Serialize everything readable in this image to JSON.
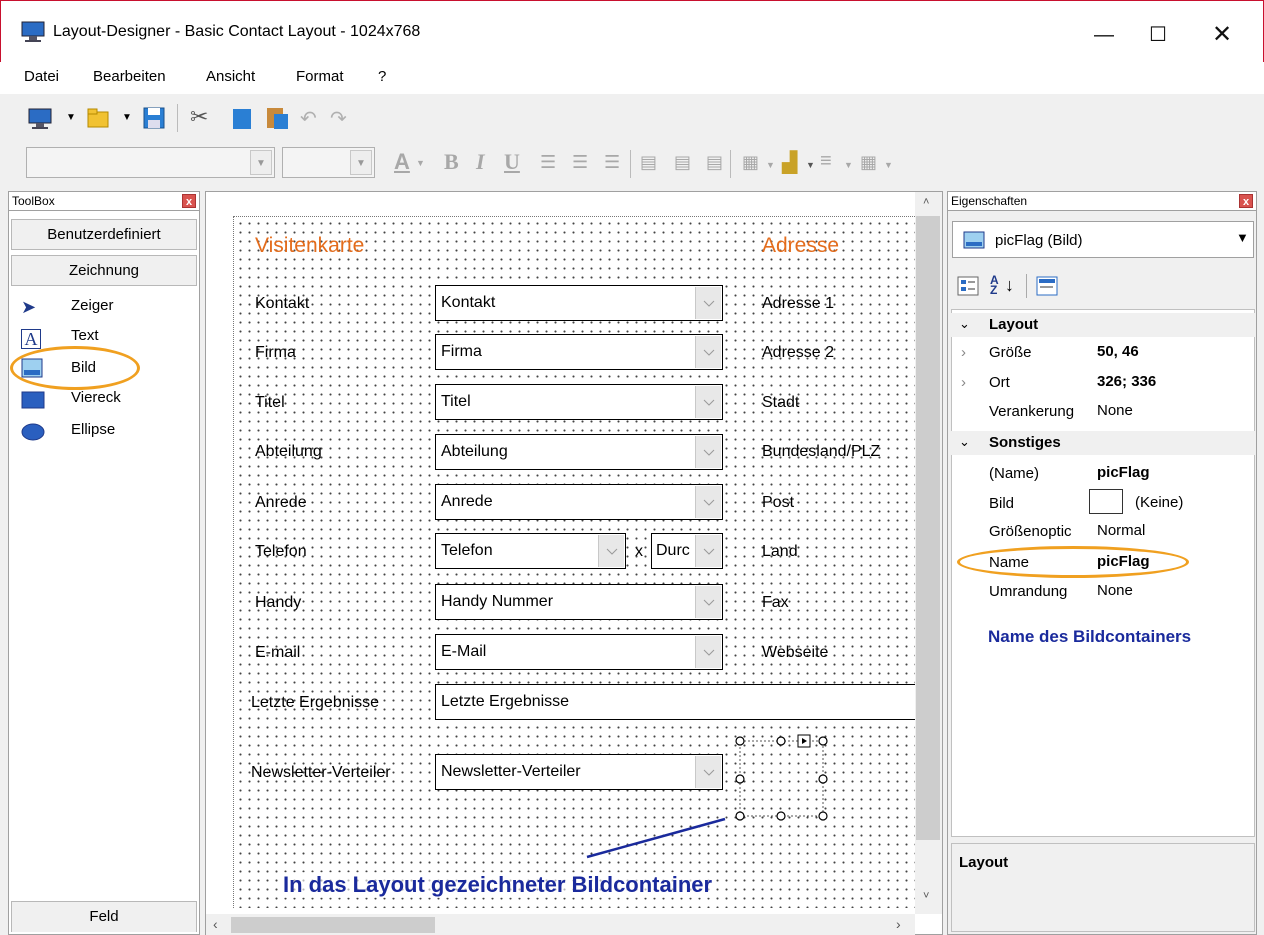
{
  "window": {
    "title": "Layout-Designer - Basic Contact Layout - 1024x768"
  },
  "menu": [
    "Datei",
    "Bearbeiten",
    "Ansicht",
    "Format",
    "?"
  ],
  "toolbox": {
    "title": "ToolBox",
    "sections": [
      "Benutzerdefiniert",
      "Zeichnung"
    ],
    "tools": [
      "Zeiger",
      "Text",
      "Bild",
      "Viereck",
      "Ellipse"
    ],
    "footer": "Feld"
  },
  "canvas": {
    "heading_left": "Visitenkarte",
    "heading_right": "Adresse",
    "rows": [
      {
        "label": "Kontakt",
        "value": "Kontakt",
        "right": "Adresse 1"
      },
      {
        "label": "Firma",
        "value": "Firma",
        "right": "Adresse 2"
      },
      {
        "label": "Titel",
        "value": "Titel",
        "right": "Stadt"
      },
      {
        "label": "Abteilung",
        "value": "Abteilung",
        "right": "Bundesland/PLZ"
      },
      {
        "label": "Anrede",
        "value": "Anrede",
        "right": "Post"
      },
      {
        "label": "Telefon",
        "value": "Telefon",
        "right": "Land"
      },
      {
        "label": "Handy",
        "value": "Handy Nummer",
        "right": "Fax"
      },
      {
        "label": "E-mail",
        "value": "E-Mail",
        "right": "Webseite"
      }
    ],
    "phone_x": "x",
    "phone_ext": "Durc",
    "letzte_label": "Letzte Ergebnisse",
    "letzte_value": "Letzte Ergebnisse",
    "newsletter_label": "Newsletter-Verteiler",
    "newsletter_value": "Newsletter-Verteiler",
    "annotation": "In das Layout gezeichneter Bildcontainer"
  },
  "properties": {
    "title": "Eigenschaften",
    "object": "picFlag (Bild)",
    "sort_label": "A Z",
    "groups": [
      {
        "name": "Layout",
        "items": [
          {
            "key": "Größe",
            "value": "50, 46"
          },
          {
            "key": "Ort",
            "value": "326; 336"
          },
          {
            "key": "Verankerung",
            "value": "None"
          }
        ]
      },
      {
        "name": "Sonstiges",
        "items": [
          {
            "key": "(Name)",
            "value": "picFlag"
          },
          {
            "key": "Bild",
            "value": "(Keine)"
          },
          {
            "key": "Größenoptic",
            "value": "Normal"
          },
          {
            "key": "Name",
            "value": "picFlag"
          },
          {
            "key": "Umrandung",
            "value": "None"
          }
        ]
      }
    ],
    "annotation": "Name des Bildcontainers",
    "description": "Layout"
  },
  "colors": {
    "annotation_blue": "#1a2a9c",
    "highlight_orange": "#f0a020",
    "heading_orange": "#e36c1c"
  }
}
